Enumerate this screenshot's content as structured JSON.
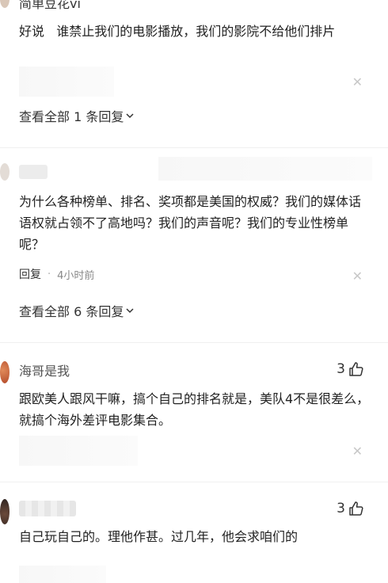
{
  "comments": [
    {
      "username": "简单豆花vi",
      "text": "好说   谁禁止我们的电影播放，我们的影院不给他们排片",
      "view_all": "查看全部 1 条回复"
    },
    {
      "username": "",
      "text": "为什么各种榜单、排名、奖项都是美国的权威？我们的媒体话语权就占领不了高地吗？我们的声音呢？我们的专业性榜单呢？",
      "reply_label": "回复",
      "time": "4小时前",
      "view_all": "查看全部 6 条回复"
    },
    {
      "username": "海哥是我",
      "text": "跟欧美人跟风干嘛，搞个自己的排名就是，美队4不是很差么，就搞个海外差评电影集合。",
      "likes": "3"
    },
    {
      "username": "",
      "text": "自己玩自己的。理他作甚。过几年，他会求咱们的",
      "likes": "3"
    }
  ],
  "icons": {
    "close": "close-icon",
    "chevron": "chevron-down-icon",
    "like": "thumbs-up-icon"
  },
  "colors": {
    "text": "#222222",
    "muted": "#888888",
    "close": "#c8c8c8"
  }
}
